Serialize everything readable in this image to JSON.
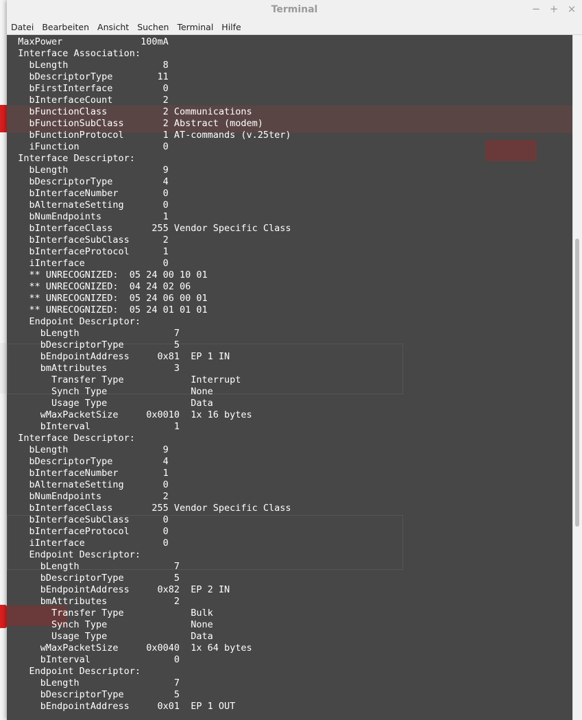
{
  "window": {
    "title": "Terminal",
    "controls": {
      "minimize": "−",
      "maximize": "+",
      "close": "×"
    }
  },
  "menu": [
    "Datei",
    "Bearbeiten",
    "Ansicht",
    "Suchen",
    "Terminal",
    "Hilfe"
  ],
  "terminal_lines": [
    "  MaxPower              100mA",
    "  Interface Association:",
    "    bLength                 8",
    "    bDescriptorType        11",
    "    bFirstInterface         0",
    "    bInterfaceCount         2",
    "    bFunctionClass          2 Communications",
    "    bFunctionSubClass       2 Abstract (modem)",
    "    bFunctionProtocol       1 AT-commands (v.25ter)",
    "    iFunction               0",
    "  Interface Descriptor:",
    "    bLength                 9",
    "    bDescriptorType         4",
    "    bInterfaceNumber        0",
    "    bAlternateSetting       0",
    "    bNumEndpoints           1",
    "    bInterfaceClass       255 Vendor Specific Class",
    "    bInterfaceSubClass      2",
    "    bInterfaceProtocol      1",
    "    iInterface              0",
    "    ** UNRECOGNIZED:  05 24 00 10 01",
    "    ** UNRECOGNIZED:  04 24 02 06",
    "    ** UNRECOGNIZED:  05 24 06 00 01",
    "    ** UNRECOGNIZED:  05 24 01 01 01",
    "    Endpoint Descriptor:",
    "      bLength                 7",
    "      bDescriptorType         5",
    "      bEndpointAddress     0x81  EP 1 IN",
    "      bmAttributes            3",
    "        Transfer Type            Interrupt",
    "        Synch Type               None",
    "        Usage Type               Data",
    "      wMaxPacketSize     0x0010  1x 16 bytes",
    "      bInterval               1",
    "  Interface Descriptor:",
    "    bLength                 9",
    "    bDescriptorType         4",
    "    bInterfaceNumber        1",
    "    bAlternateSetting       0",
    "    bNumEndpoints           2",
    "    bInterfaceClass       255 Vendor Specific Class",
    "    bInterfaceSubClass      0",
    "    bInterfaceProtocol      0",
    "    iInterface              0",
    "    Endpoint Descriptor:",
    "      bLength                 7",
    "      bDescriptorType         5",
    "      bEndpointAddress     0x82  EP 2 IN",
    "      bmAttributes            2",
    "        Transfer Type            Bulk",
    "        Synch Type               None",
    "        Usage Type               Data",
    "      wMaxPacketSize     0x0040  1x 64 bytes",
    "      bInterval               0",
    "    Endpoint Descriptor:",
    "      bLength                 7",
    "      bDescriptorType         5",
    "      bEndpointAddress     0x01  EP 1 OUT"
  ]
}
